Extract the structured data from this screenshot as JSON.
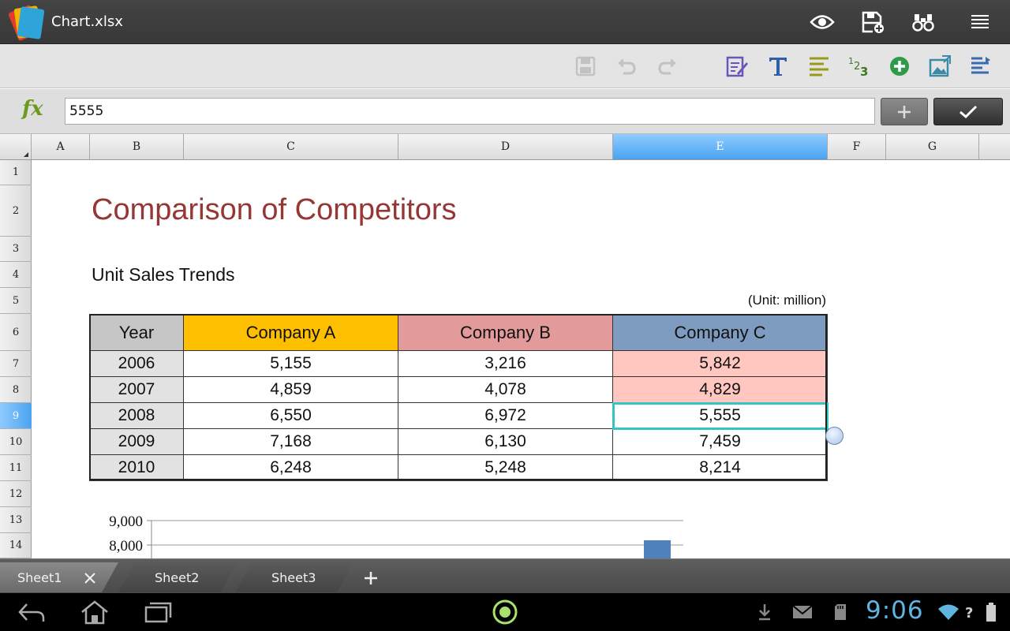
{
  "app": {
    "file_title": "Chart.xlsx",
    "top_icons": [
      "eye-icon",
      "save-as-icon",
      "binoculars-icon",
      "menu-icon"
    ]
  },
  "toolbar": {
    "icons": [
      "save-icon",
      "undo-icon",
      "redo-icon",
      "edit-document-icon",
      "text-format-icon",
      "align-icon",
      "number-format-icon",
      "insert-icon",
      "image-icon",
      "table-format-icon"
    ],
    "disabled": [
      "save-icon",
      "undo-icon",
      "redo-icon"
    ]
  },
  "formula_bar": {
    "label": "fx",
    "value": "5555"
  },
  "columns": [
    "A",
    "B",
    "C",
    "D",
    "E",
    "F",
    "G"
  ],
  "selected_column": "E",
  "rows": [
    "1",
    "2",
    "3",
    "4",
    "5",
    "6",
    "7",
    "8",
    "9",
    "10",
    "11",
    "12",
    "13",
    "14"
  ],
  "selected_row": "9",
  "sheet": {
    "title": "Comparison of Competitors",
    "subtitle": "Unit Sales Trends",
    "unit_note": "(Unit: million)",
    "table": {
      "headers": [
        "Year",
        "Company A",
        "Company B",
        "Company C"
      ],
      "rows": [
        [
          "2006",
          "5,155",
          "3,216",
          "5,842"
        ],
        [
          "2007",
          "4,859",
          "4,078",
          "4,829"
        ],
        [
          "2008",
          "6,550",
          "6,972",
          "5,555"
        ],
        [
          "2009",
          "7,168",
          "6,130",
          "7,459"
        ],
        [
          "2010",
          "6,248",
          "5,248",
          "8,214"
        ]
      ]
    },
    "colors": {
      "title": "#953734",
      "year_header": "#c6c6c6",
      "company_a_header": "#fdbf00",
      "company_b_header": "#e29a9a",
      "company_c_header": "#7e9bc0",
      "highlight_cells": "#ffc7c0",
      "active_cell_border": "#33c5c3"
    }
  },
  "chart": {
    "y_ticks": [
      "9,000",
      "8,000"
    ]
  },
  "sheet_tabs": {
    "tabs": [
      "Sheet1",
      "Sheet2",
      "Sheet3"
    ],
    "active": "Sheet1"
  },
  "status": {
    "time": "9:06"
  }
}
